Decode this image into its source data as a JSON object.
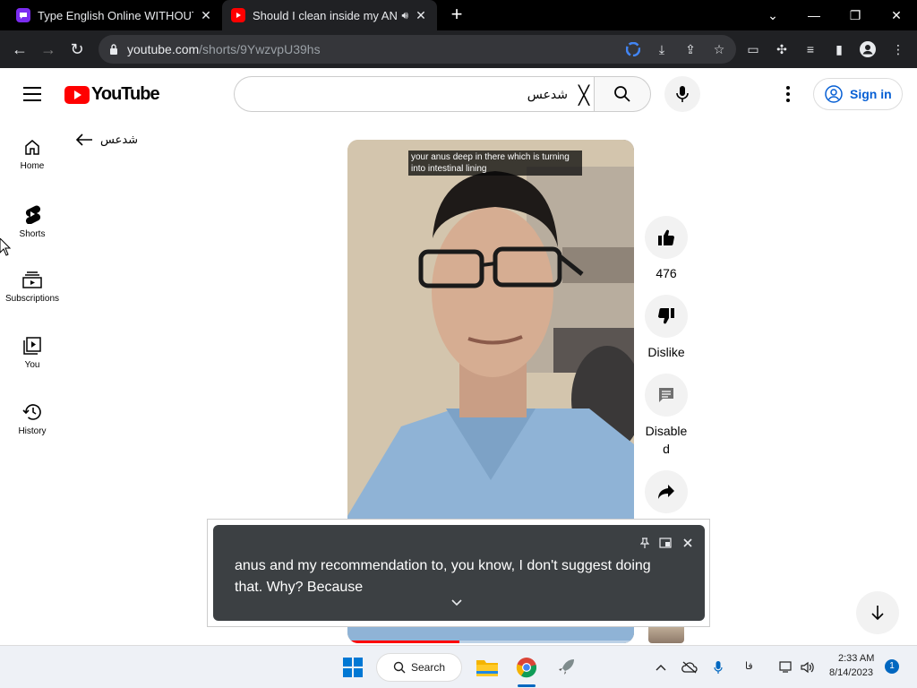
{
  "browser": {
    "tabs": [
      {
        "title": "Type English Online WITHOUT an"
      },
      {
        "title": "Should I clean inside my ANUS"
      }
    ],
    "url_host": "youtube.com",
    "url_path": "/shorts/9YwzvpU39hs"
  },
  "youtube": {
    "logo_text": "YouTube",
    "search_value": "شدعس",
    "sign_in_label": "Sign in",
    "back_label": "شدعس",
    "sidebar": [
      {
        "label": "Home"
      },
      {
        "label": "Shorts"
      },
      {
        "label": "Subscriptions"
      },
      {
        "label": "You"
      },
      {
        "label": "History"
      }
    ],
    "video": {
      "caption": "your anus deep in there which is turning into intestinal lining",
      "progress": 0.39
    },
    "actions": {
      "like_count": "476",
      "dislike_label": "Dislike",
      "comments_label": "Disabled"
    }
  },
  "live_caption": {
    "text": "anus and my recommendation to, you know, I don't suggest doing that. Why? Because"
  },
  "taskbar": {
    "search_label": "Search",
    "lang": "فا",
    "time": "2:33 AM",
    "date": "8/14/2023",
    "notification_count": "1"
  },
  "colors": {
    "brand_red": "#ff0000",
    "link_blue": "#065fd4",
    "chrome_dark": "#202124"
  }
}
